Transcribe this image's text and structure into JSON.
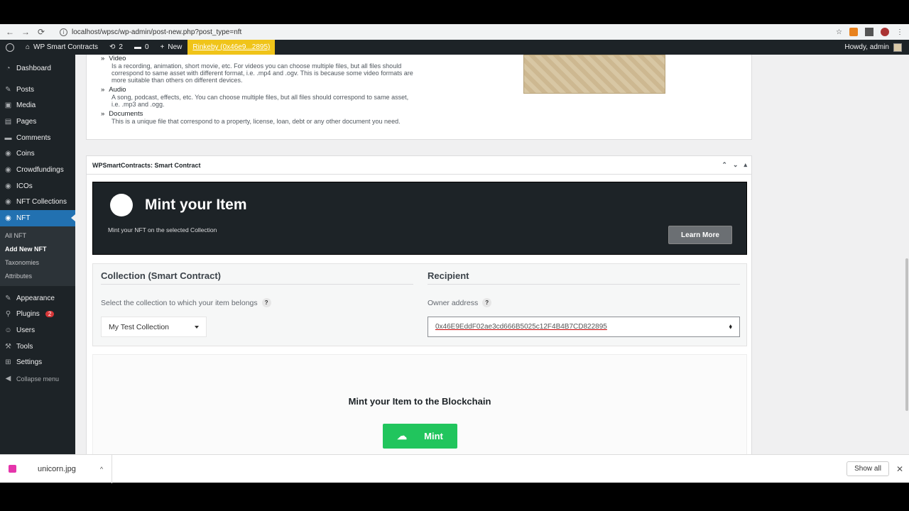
{
  "browser": {
    "url": "localhost/wpsc/wp-admin/post-new.php?post_type=nft",
    "back": "←",
    "forward": "→",
    "reload": "⟳",
    "star": "☆",
    "menu": "⋮"
  },
  "adminbar": {
    "site_name": "WP Smart Contracts",
    "updates_count": "2",
    "comments_count": "0",
    "new_label": "New",
    "network": "Rinkeby (0x46e9...2895)",
    "howdy": "Howdy, admin"
  },
  "sidebar": {
    "items": [
      {
        "label": "Dashboard",
        "icon": "◔"
      },
      {
        "label": "Posts",
        "icon": "✎"
      },
      {
        "label": "Media",
        "icon": "▣"
      },
      {
        "label": "Pages",
        "icon": "▤"
      },
      {
        "label": "Comments",
        "icon": "▬"
      },
      {
        "label": "Coins",
        "icon": "◉"
      },
      {
        "label": "Crowdfundings",
        "icon": "◉"
      },
      {
        "label": "ICOs",
        "icon": "◉"
      },
      {
        "label": "NFT Collections",
        "icon": "◉"
      },
      {
        "label": "NFT",
        "icon": "◉"
      }
    ],
    "submenu": [
      "All NFT",
      "Add New NFT",
      "Taxonomies",
      "Attributes"
    ],
    "items2": [
      {
        "label": "Appearance",
        "icon": "✎"
      },
      {
        "label": "Plugins",
        "icon": "⚲"
      },
      {
        "label": "Users",
        "icon": "☺"
      },
      {
        "label": "Tools",
        "icon": "⚒"
      },
      {
        "label": "Settings",
        "icon": "⊞"
      }
    ],
    "plugins_badge": "2",
    "collapse": "Collapse menu"
  },
  "media_types": [
    {
      "title": "Video",
      "desc": "Is a recording, animation, short movie, etc. For videos you can choose multiple files, but all files should correspond to same asset with different format, i.e. .mp4 and .ogv. This is because some video formats are more suitable than others on different devices."
    },
    {
      "title": "Audio",
      "desc": "A song, podcast, effects, etc. You can choose multiple files, but all files should correspond to same asset, i.e. .mp3 and .ogg."
    },
    {
      "title": "Documents",
      "desc": "This is a unique file that correspond to a property, license, loan, debt or any other document you need."
    }
  ],
  "smart_contract": {
    "header": "WPSmartContracts: Smart Contract",
    "hero_title": "Mint your Item",
    "hero_sub": "Mint your NFT on the selected Collection",
    "learn_more": "Learn More",
    "collection_title": "Collection (Smart Contract)",
    "collection_label": "Select the collection to which your item belongs",
    "collection_value": "My Test Collection",
    "recipient_title": "Recipient",
    "owner_label": "Owner address",
    "owner_value": "0x46E9EddF02ae3cd666B5025c12F4B4B7CD822895",
    "help": "?",
    "mint_title": "Mint your Item to the Blockchain",
    "mint_button": "Mint"
  },
  "downloads": {
    "file": "unicorn.jpg",
    "show_all": "Show all"
  },
  "colors": {
    "wp_dark": "#1d2327",
    "wp_blue": "#2271b1",
    "mint_green": "#21c55d",
    "network_yellow": "#f0c419"
  }
}
